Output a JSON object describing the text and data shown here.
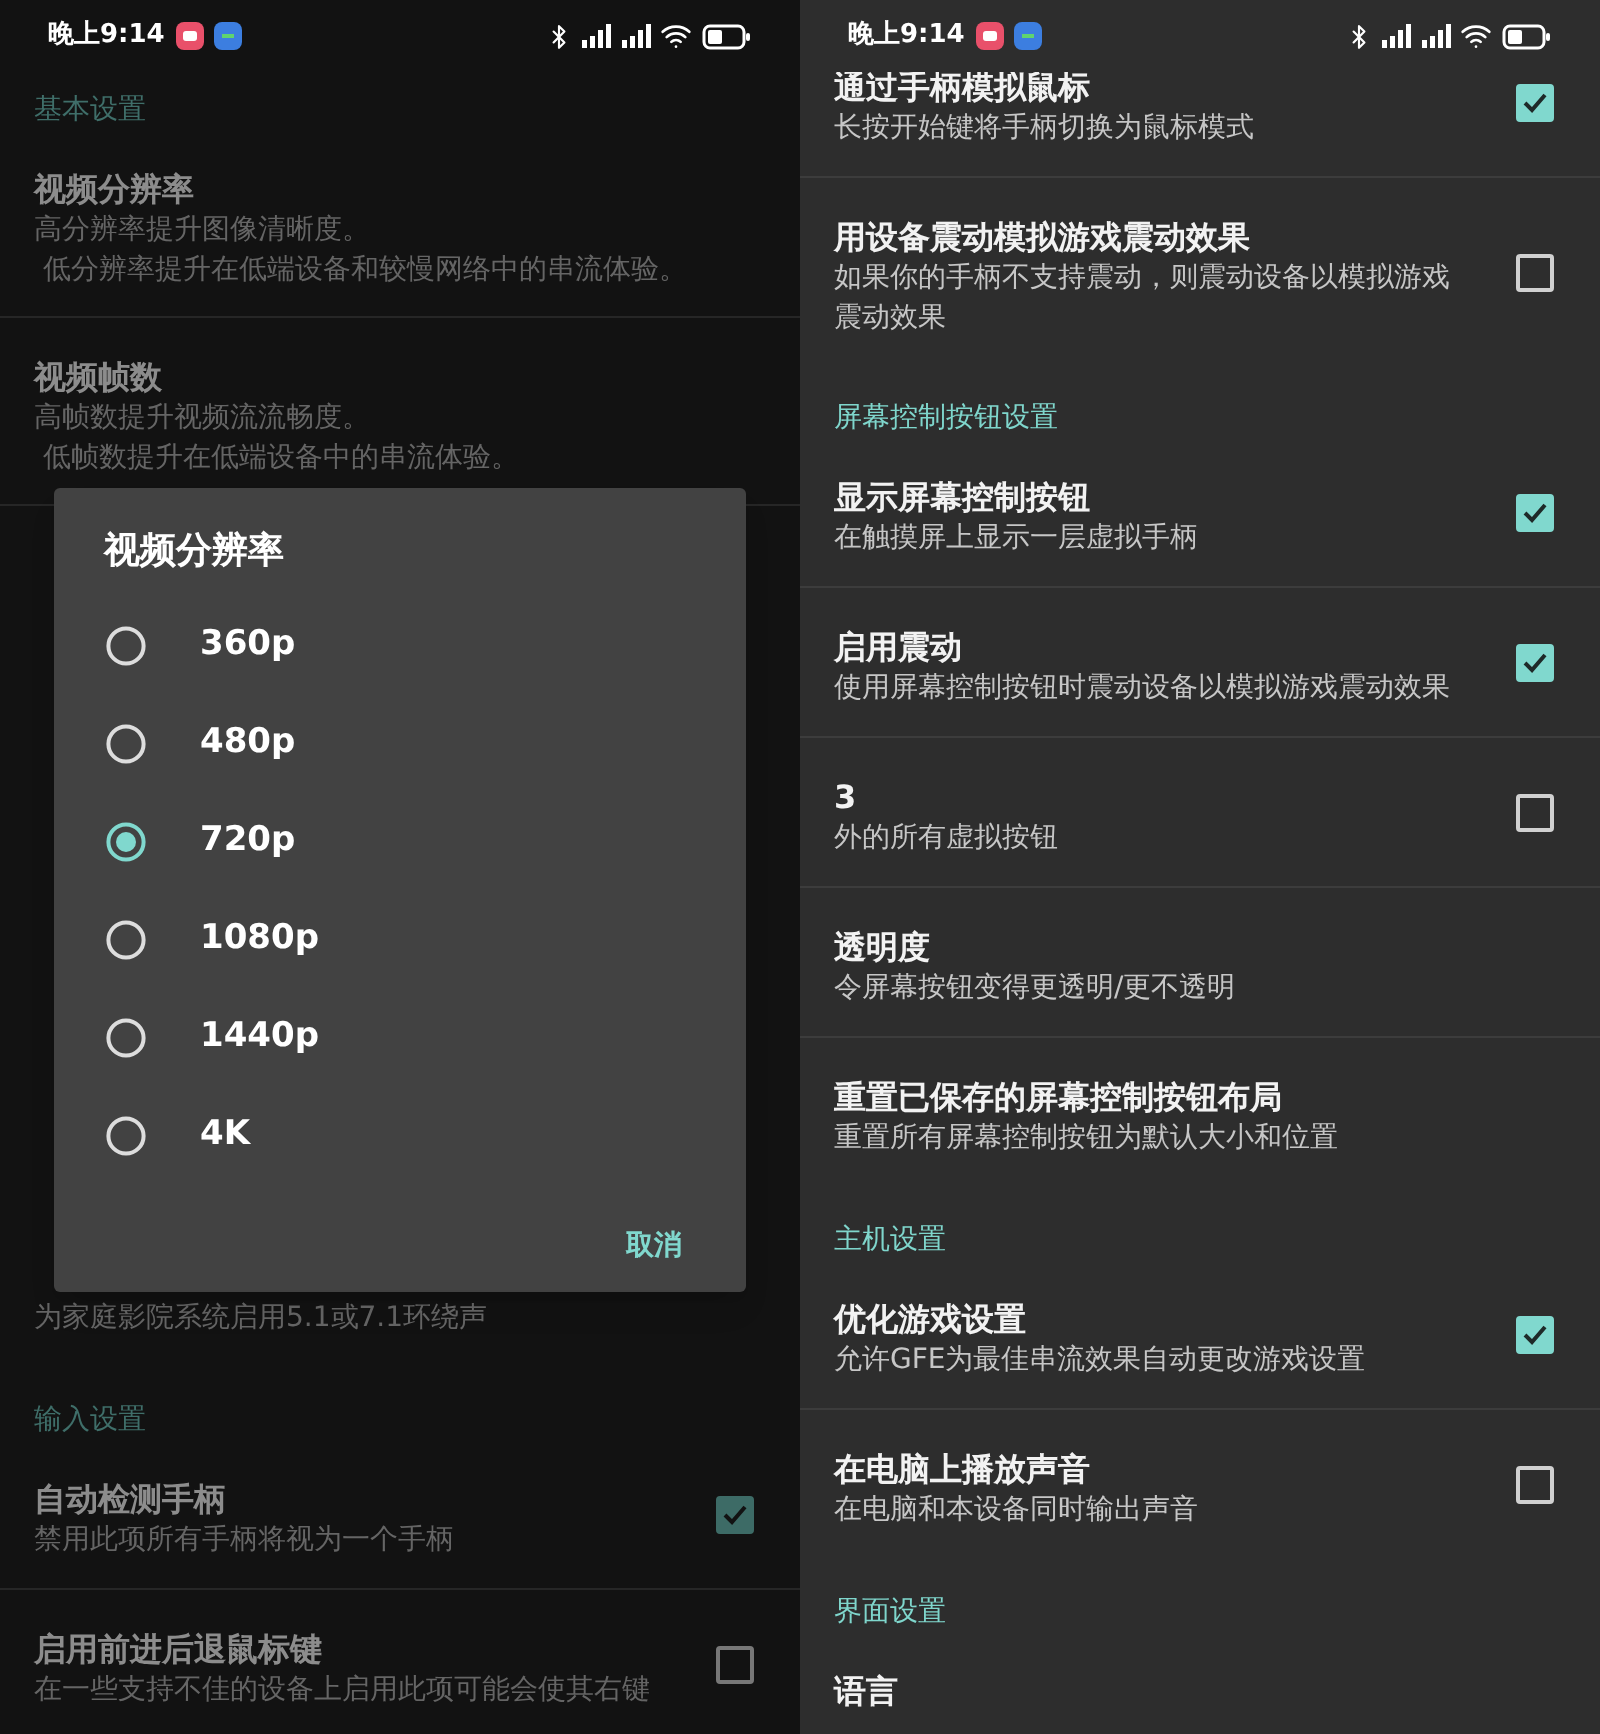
{
  "panels": [
    {
      "dimmed": true,
      "status_bar": {
        "time": "晚上9:14"
      },
      "items": [
        {
          "kind": "section",
          "title": "基本设置"
        },
        {
          "kind": "setting",
          "title": "视频分辨率",
          "summary": [
            "高分辨率提升图像清晰度。",
            " 低分辨率提升在低端设备和较慢网络中的串流体验。"
          ]
        },
        {
          "kind": "setting",
          "title": "视频帧数",
          "summary": [
            "高帧数提升视频流流畅度。",
            " 低帧数提升在低端设备中的串流体验。"
          ]
        },
        {
          "kind": "dialog",
          "title": "视频分辨率",
          "options": [
            {
              "label": "360p",
              "selected": false
            },
            {
              "label": "480p",
              "selected": false
            },
            {
              "label": "720p",
              "selected": true
            },
            {
              "label": "1080p",
              "selected": false
            },
            {
              "label": "1440p",
              "selected": false
            },
            {
              "label": "4K",
              "selected": false
            }
          ],
          "cancel": "取消"
        },
        {
          "kind": "setting",
          "summary": [
            "为家庭影院系统启用5.1或7.1环绕声"
          ]
        },
        {
          "kind": "section",
          "title": "输入设置"
        },
        {
          "kind": "checkbox",
          "title": "自动检测手柄",
          "summary": [
            "禁用此项所有手柄将视为一个手柄"
          ],
          "checked": true
        },
        {
          "kind": "checkbox",
          "title": "启用前进后退鼠标键",
          "summary": [
            "在一些支持不佳的设备上启用此项可能会使其右键"
          ],
          "checked": false
        }
      ]
    },
    {
      "dimmed": false,
      "status_bar": {
        "time": "晚上9:14"
      },
      "items": [
        {
          "kind": "checkbox",
          "title": "通过手柄模拟鼠标",
          "summary": [
            "长按开始键将手柄切换为鼠标模式"
          ],
          "checked": true
        },
        {
          "kind": "checkbox",
          "title": "用设备震动模拟游戏震动效果",
          "summary": [
            "如果你的手柄不支持震动，则震动设备以模拟游戏",
            "震动效果"
          ],
          "checked": false
        },
        {
          "kind": "section",
          "title": "屏幕控制按钮设置"
        },
        {
          "kind": "checkbox",
          "title": "显示屏幕控制按钮",
          "summary": [
            "在触摸屏上显示一层虚拟手柄"
          ],
          "checked": true
        },
        {
          "kind": "checkbox",
          "title": "启用震动",
          "summary": [
            "使用屏幕控制按钮时震动设备以模拟游戏震动效果"
          ],
          "checked": true
        },
        {
          "kind": "checkbox",
          "title": "3",
          "summary": [
            "外的所有虚拟按钮"
          ],
          "checked": false
        },
        {
          "kind": "setting",
          "title": "透明度",
          "summary": [
            "令屏幕按钮变得更透明/更不透明"
          ]
        },
        {
          "kind": "setting",
          "title": "重置已保存的屏幕控制按钮布局",
          "summary": [
            "重置所有屏幕控制按钮为默认大小和位置"
          ]
        },
        {
          "kind": "section",
          "title": "主机设置"
        },
        {
          "kind": "checkbox",
          "title": "优化游戏设置",
          "summary": [
            "允许GFE为最佳串流效果自动更改游戏设置"
          ],
          "checked": true
        },
        {
          "kind": "checkbox",
          "title": "在电脑上播放声音",
          "summary": [
            "在电脑和本设备同时输出声音"
          ],
          "checked": false
        },
        {
          "kind": "section",
          "title": "界面设置"
        },
        {
          "kind": "setting",
          "title": "语言"
        }
      ]
    }
  ]
}
